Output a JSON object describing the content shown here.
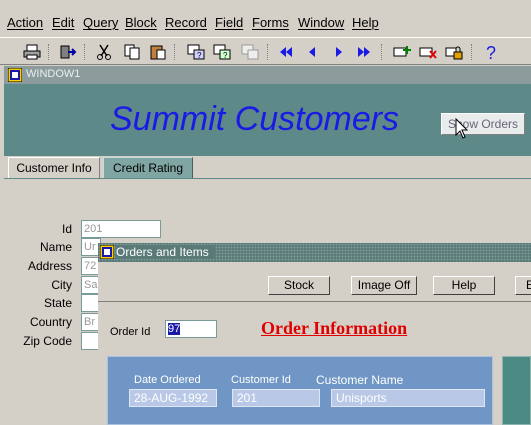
{
  "menu": [
    "Action",
    "Edit",
    "Query",
    "Block",
    "Record",
    "Field",
    "Forms",
    "Window",
    "Help"
  ],
  "toolbar_icons": [
    "print-icon",
    "exit-icon",
    "cut-icon",
    "copy-icon",
    "paste-icon",
    "enter-query-icon",
    "execute-query-icon",
    "cancel-query-icon",
    "first-record-icon",
    "previous-record-icon",
    "next-record-icon",
    "last-record-icon",
    "insert-record-icon",
    "delete-record-icon",
    "lock-record-icon",
    "help-icon"
  ],
  "window1": {
    "title": "WINDOW1",
    "page_title": "Summit Customers",
    "show_orders_label": "Show Orders",
    "tabs": [
      "Customer Info",
      "Credit Rating"
    ],
    "labels": {
      "id": "Id",
      "name": "Name",
      "address": "Address",
      "city": "City",
      "state": "State",
      "country": "Country",
      "zip": "Zip Code"
    },
    "values": {
      "id": "201",
      "name": "Ur",
      "address": "72",
      "city": "Sa",
      "state": "",
      "country": "Br",
      "zip": ""
    }
  },
  "orders": {
    "title": "Orders and Items",
    "buttons": [
      "Stock",
      "Image Off",
      "Help",
      "E"
    ],
    "order_id_label": "Order Id",
    "order_id": "97",
    "heading": "Order Information",
    "date_ordered_label": "Date Ordered",
    "date_ordered": "28-AUG-1992",
    "customer_id_label": "Customer Id",
    "customer_id": "201",
    "customer_name_label": "Customer Name",
    "customer_name": "Unisports"
  },
  "colors": {
    "title_blue": "#1a1ae6",
    "heading_red": "#e00000",
    "panel_teal": "#5d8988",
    "panel_blue": "#6f96c4"
  }
}
